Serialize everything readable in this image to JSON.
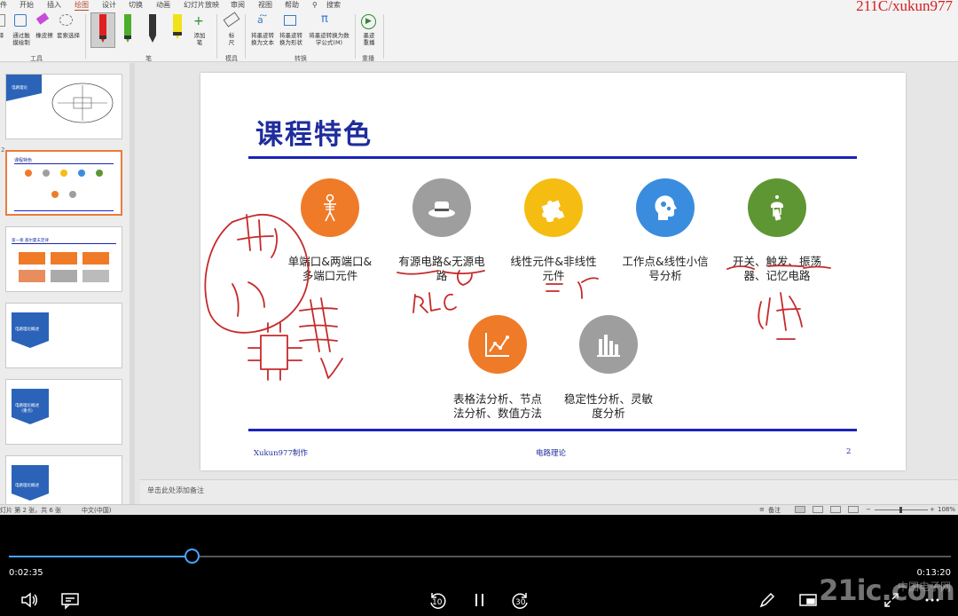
{
  "menu": {
    "items": [
      "件",
      "开始",
      "插入",
      "绘图",
      "设计",
      "切换",
      "动画",
      "幻灯片放映",
      "审阅",
      "视图",
      "帮助",
      "搜索"
    ],
    "active_index": 3
  },
  "watermark_top": "211C/xukun977",
  "ribbon": {
    "tools_buttons": [
      "择",
      "通过触\n摸绘制",
      "橡皮擦",
      "套索选择"
    ],
    "tools_group": "工具",
    "pens_group": "笔",
    "add_pen": "添加\n笔",
    "ruler": "标\n尺",
    "ruler_group": "模具",
    "convert_buttons": [
      "将墨迹转\n换为文本",
      "将墨迹转\n换为形状",
      "将墨迹转换为数\n学公式(M)"
    ],
    "convert_group": "转换",
    "replay": "墨迹\n重播",
    "replay_group": "重播"
  },
  "thumbs": [
    {
      "num": "1",
      "title": "电路理论"
    },
    {
      "num": "2",
      "title": "课程特色"
    },
    {
      "num": "3",
      "title": "第一章 基尔霍夫定律"
    },
    {
      "num": "4",
      "title": "电路理论概述"
    },
    {
      "num": "5",
      "title": "电路理论概述\n(重点)"
    },
    {
      "num": "6",
      "title": "电路理论概述"
    }
  ],
  "slide": {
    "title": "课程特色",
    "features": [
      {
        "label": "单端口&两端口&\n多端口元件",
        "color": "#ef7b28",
        "icon": "skeleton-icon"
      },
      {
        "label": "有源电路&无源电\n路",
        "color": "#9e9e9e",
        "icon": "hat-icon"
      },
      {
        "label": "线性元件&非线性\n元件",
        "color": "#f5bd12",
        "icon": "puzzle-icon"
      },
      {
        "label": "工作点&线性小信\n号分析",
        "color": "#3a8dde",
        "icon": "head-gears-icon"
      },
      {
        "label": "开关、触发、振荡\n器、记忆电路",
        "color": "#5f9634",
        "icon": "wind-chime-icon"
      },
      {
        "label": "表格法分析、节点\n法分析、数值方法",
        "color": "#ef7b28",
        "icon": "line-chart-icon"
      },
      {
        "label": "稳定性分析、灵敏\n度分析",
        "color": "#9e9e9e",
        "icon": "bar-chart-icon"
      }
    ],
    "footer_left": "Xukun977制作",
    "footer_mid": "电路理论",
    "footer_right": "2"
  },
  "ink_annotations": [
    "RLC"
  ],
  "notes_placeholder": "单击此处添加备注",
  "status": {
    "left": "灯片 第 2 张，共 6 张",
    "lang": "中文(中国)",
    "notes_btn": "备注",
    "zoom": "108%"
  },
  "player": {
    "current": "0:02:35",
    "total": "0:13:20",
    "progress": 0.194,
    "skip_back": "10",
    "skip_fwd": "30"
  },
  "watermark_bottom": "21ic.com",
  "watermark_bottom_cn": "中国电子网"
}
